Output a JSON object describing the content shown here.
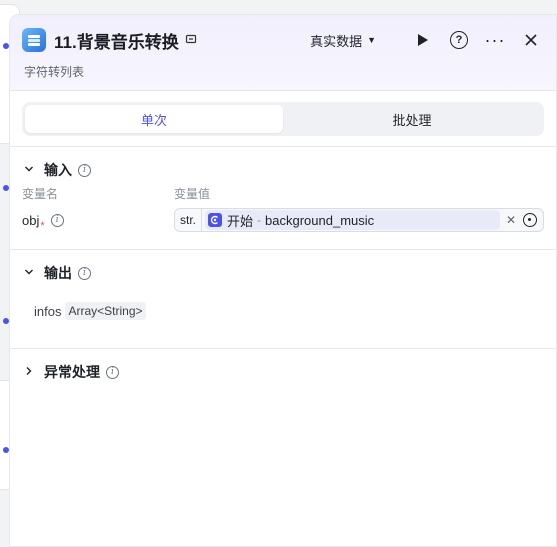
{
  "header": {
    "title": "11.背景音乐转换",
    "subtitle": "字符转列表",
    "data_select": "真实数据"
  },
  "tabs": [
    {
      "label": "单次",
      "active": true
    },
    {
      "label": "批处理",
      "active": false
    }
  ],
  "input": {
    "section_title": "输入",
    "col_name": "变量名",
    "col_value": "变量值",
    "params": [
      {
        "name": "obj",
        "required_mark": "*",
        "type": "str.",
        "ref_node": "开始",
        "ref_sep": "-",
        "ref_var": "background_music"
      }
    ]
  },
  "output": {
    "section_title": "输出",
    "fields": [
      {
        "name": "infos",
        "type": "Array<String>"
      }
    ]
  },
  "exception": {
    "section_title": "异常处理"
  },
  "colors": {
    "accent": "#4d53e8",
    "header_bg": "#f1effd",
    "error": "#e64a66"
  }
}
